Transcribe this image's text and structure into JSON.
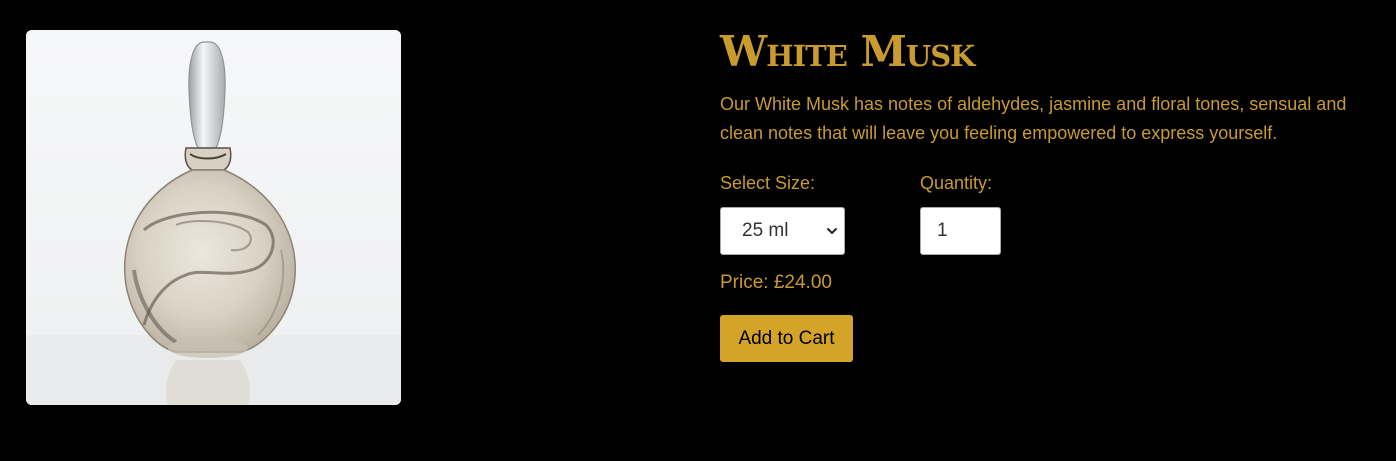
{
  "product": {
    "title": "White Musk",
    "description": "Our White Musk has notes of aldehydes, jasmine and floral tones, sensual and clean notes that will leave you feeling empowered to express yourself.",
    "image_alt": "White Musk perfume bottle",
    "size_label": "Select Size:",
    "size_selected": "25 ml",
    "quantity_label": "Quantity:",
    "quantity_value": "1",
    "price_text": "Price: £24.00",
    "add_to_cart_label": "Add to Cart"
  },
  "colors": {
    "background": "#000000",
    "accent": "#c99a2e",
    "button": "#d4a428"
  },
  "icons": {
    "select_arrow": "chevron-down-icon"
  }
}
